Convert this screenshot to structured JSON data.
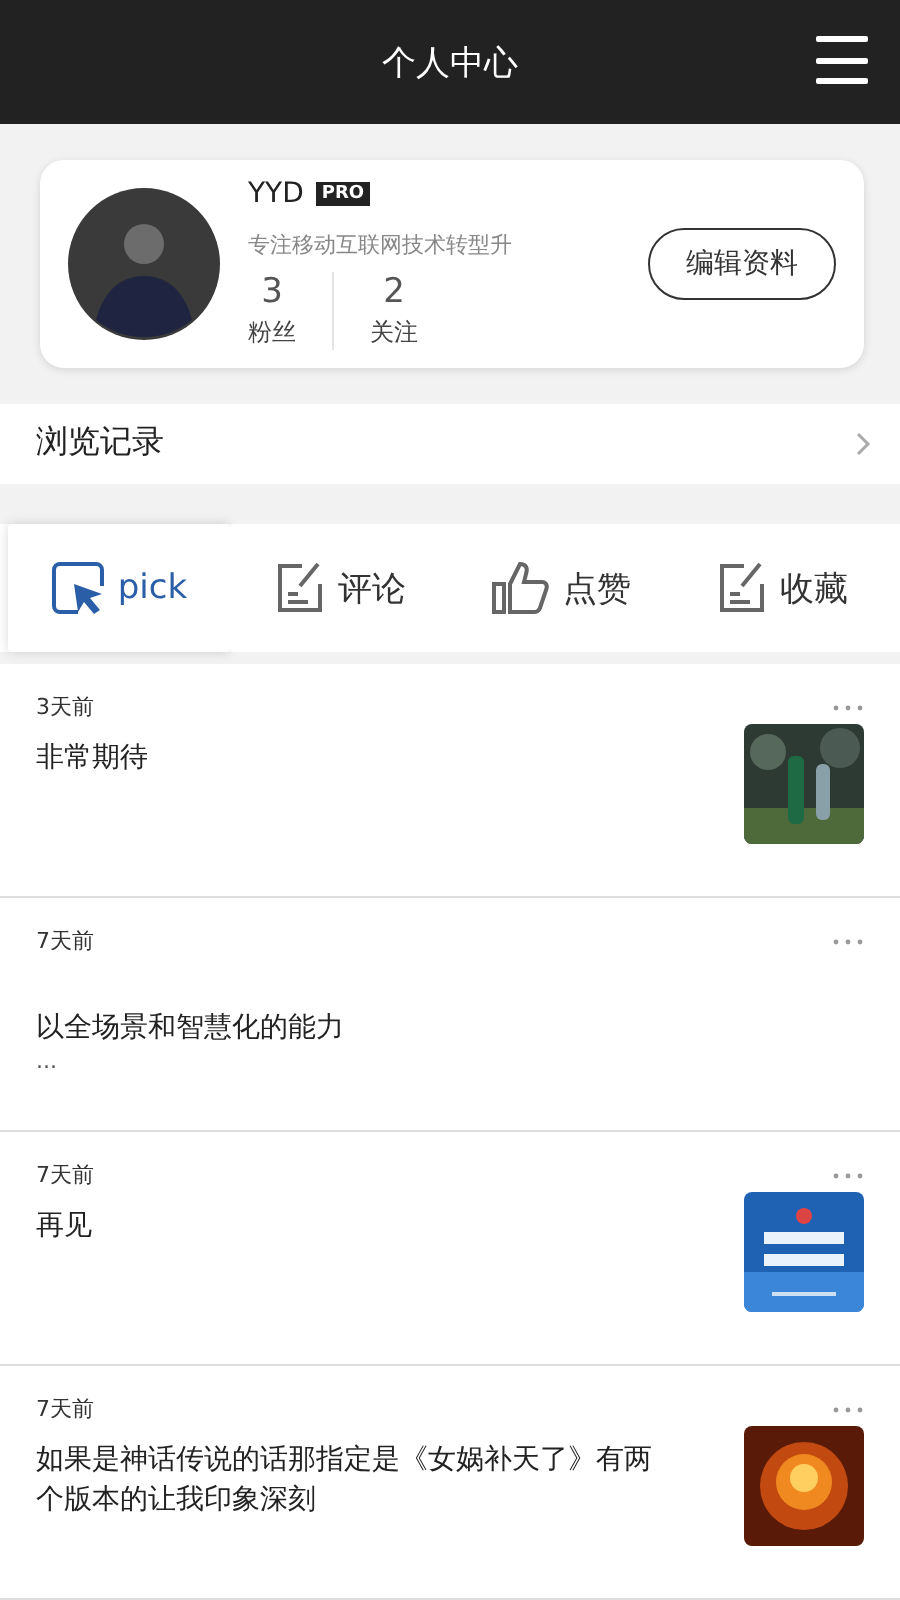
{
  "header": {
    "title": "个人中心"
  },
  "profile": {
    "name": "YYD",
    "badge": "PRO",
    "bio": "专注移动互联网技术转型升",
    "stats": [
      {
        "value": "3",
        "label": "粉丝"
      },
      {
        "value": "2",
        "label": "关注"
      }
    ],
    "edit_button": "编辑资料"
  },
  "history": {
    "label": "浏览记录"
  },
  "tabs": [
    {
      "kind": "cursor",
      "label": "pick",
      "selected": true
    },
    {
      "kind": "note",
      "label": "评论",
      "selected": false
    },
    {
      "kind": "thumb",
      "label": "点赞",
      "selected": false
    },
    {
      "kind": "note",
      "label": "收藏",
      "selected": false
    }
  ],
  "items": [
    {
      "time": "3天前",
      "text": "非常期待"
    },
    {
      "time": "7天前",
      "text": "以全场景和智慧化的能力",
      "extra": "..."
    },
    {
      "time": "7天前",
      "text": "再见"
    },
    {
      "time": "7天前",
      "text": "如果是神话传说的话那指定是《女娲补天了》有两个版本的让我印象深刻"
    }
  ]
}
